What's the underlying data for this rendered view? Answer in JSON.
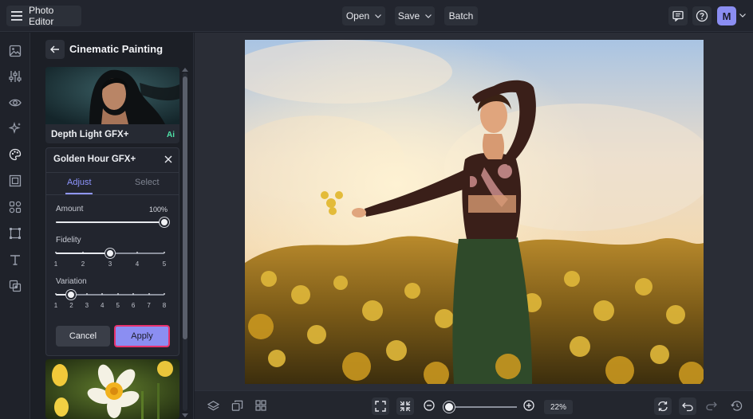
{
  "app": {
    "name": "Photo Editor"
  },
  "topbar": {
    "open_label": "Open",
    "save_label": "Save",
    "batch_label": "Batch",
    "avatar_initial": "M"
  },
  "panel": {
    "title": "Cinematic Painting",
    "effect_card": {
      "label": "Depth Light GFX+",
      "badge": "Ai"
    },
    "adjust_card": {
      "title": "Golden Hour GFX+",
      "tabs": [
        {
          "label": "Adjust",
          "active": true
        },
        {
          "label": "Select",
          "active": false
        }
      ],
      "amount": {
        "label": "Amount",
        "value_text": "100%",
        "value": 100
      },
      "fidelity": {
        "label": "Fidelity",
        "value": 3,
        "ticks": [
          "1",
          "2",
          "3",
          "4",
          "5"
        ]
      },
      "variation": {
        "label": "Variation",
        "value": 2,
        "ticks": [
          "1",
          "2",
          "3",
          "4",
          "5",
          "6",
          "7",
          "8"
        ]
      },
      "cancel_label": "Cancel",
      "apply_label": "Apply"
    }
  },
  "bottombar": {
    "zoom_text": "22%",
    "zoom_value": 22
  },
  "colors": {
    "accent": "#8b8ef2",
    "highlight_border": "#e8326e",
    "ai_badge": "#4fe3a8",
    "background": "#1c1f27"
  },
  "icons": {
    "rail": [
      "image-icon",
      "sliders-icon",
      "eye-icon",
      "sparkle-icon",
      "palette-icon",
      "frame-icon",
      "shapes-icon",
      "crop-icon",
      "text-icon",
      "overlay-icon"
    ],
    "topbar": [
      "menu-icon",
      "feedback-icon",
      "help-icon"
    ],
    "bottombar": [
      "layers-icon",
      "copy-icon",
      "grid-icon",
      "fit-screen-icon",
      "actual-size-icon",
      "zoom-out-icon",
      "zoom-in-icon",
      "compare-icon",
      "undo-icon",
      "redo-icon",
      "history-icon"
    ]
  }
}
